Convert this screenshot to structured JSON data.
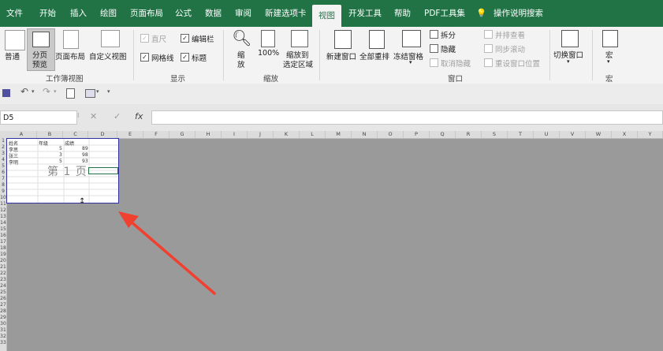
{
  "tabs": [
    {
      "label": "文件"
    },
    {
      "label": "开始"
    },
    {
      "label": "插入"
    },
    {
      "label": "绘图"
    },
    {
      "label": "页面布局"
    },
    {
      "label": "公式"
    },
    {
      "label": "数据"
    },
    {
      "label": "审阅"
    },
    {
      "label": "新建选项卡"
    },
    {
      "label": "视图",
      "active": true
    },
    {
      "label": "开发工具"
    },
    {
      "label": "帮助"
    },
    {
      "label": "PDF工具集"
    }
  ],
  "tell_me": "操作说明搜索",
  "ribbon": {
    "workbook_view": {
      "normal": "普通",
      "page_break_preview": "分页",
      "page_break_preview_line2": "预览",
      "page_layout": "页面布局",
      "custom_view": "自定义视图",
      "group_label": "工作簿视图"
    },
    "show": {
      "ruler": "直尺",
      "formula_bar": "编辑栏",
      "gridlines": "网格线",
      "headings": "标题",
      "group_label": "显示"
    },
    "zoom": {
      "zoom": "缩",
      "zoom_line2": "放",
      "hundred": "100%",
      "zoom_selection": "缩放到",
      "zoom_selection_line2": "选定区域",
      "group_label": "缩放"
    },
    "window": {
      "new_window": "新建窗口",
      "arrange_all": "全部重排",
      "freeze_panes": "冻结窗格",
      "split": "拆分",
      "hide": "隐藏",
      "unhide": "取消隐藏",
      "side_by_side": "并排查看",
      "sync_scroll": "同步滚动",
      "reset_position": "重设窗口位置",
      "switch_windows": "切换窗口",
      "group_label": "窗口"
    },
    "macros": {
      "macros": "宏",
      "group_label": "宏"
    }
  },
  "name_box": "D5",
  "formula_icons": {
    "cancel": "✕",
    "enter": "✓",
    "fx": "fx"
  },
  "columns": [
    "A",
    "B",
    "C",
    "D",
    "E",
    "F",
    "G",
    "H",
    "I",
    "J",
    "K",
    "L",
    "M",
    "N",
    "O",
    "P",
    "Q",
    "R",
    "S",
    "T",
    "U",
    "V",
    "W",
    "X",
    "Y"
  ],
  "rows": [
    "1",
    "2",
    "3",
    "4",
    "5",
    "6",
    "7",
    "8",
    "9",
    "10",
    "11",
    "12",
    "13",
    "14",
    "15",
    "16",
    "17",
    "18",
    "19",
    "20",
    "21",
    "22",
    "23",
    "24",
    "25",
    "26",
    "27",
    "28",
    "29",
    "30",
    "31",
    "32",
    "33"
  ],
  "sheet": {
    "headers": [
      "姓名",
      "年级",
      "成绩"
    ],
    "data": [
      [
        "李思",
        "5",
        "89"
      ],
      [
        "张三",
        "3",
        "98"
      ],
      [
        "李明",
        "5",
        "93"
      ]
    ],
    "watermark": "第 1 页"
  }
}
